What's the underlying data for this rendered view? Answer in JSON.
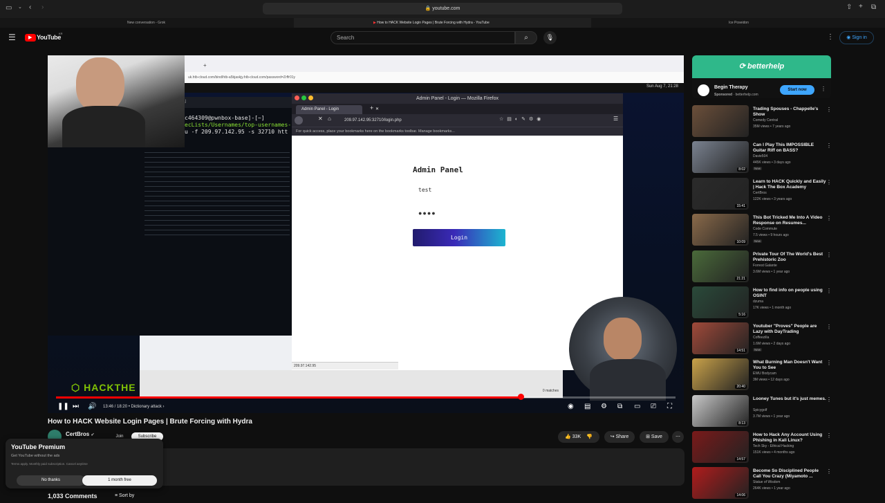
{
  "browser": {
    "url": "youtube.com",
    "tabs": [
      {
        "label": "New conversation - Grok"
      },
      {
        "label": "How to HACK Website Login Pages | Brute Forcing with Hydra - YouTube"
      },
      {
        "label": "Ice Poseidon"
      }
    ]
  },
  "youtube": {
    "logo": "YouTube",
    "logo_badge": "KR",
    "search_placeholder": "Search",
    "sign_in": "Sign in"
  },
  "video": {
    "inner_url": "uk.htb-cloud.com/bind/htb-a5bjaskjy.htb-cloud.com/password=Zrffr01y",
    "clock": "Sun Aug 7, 21:28",
    "terminal_title": "Parrot Terminal",
    "terminal_lines": [
      "c464309@pwnbox-base]-[~]",
      "ecLists/Usernames/top-usernames-",
      "u  -f 209.97.142.95 -s 32710 htt"
    ],
    "firefox_title": "Admin Panel - Login — Mozilla Firefox",
    "firefox_tab": "Admin Panel - Login",
    "firefox_url": "209.97.142.95:32710/login.php",
    "bookmarks_text": "For quick access, place your bookmarks here on the bookmarks toolbar. Manage bookmarks...",
    "admin_title": "Admin Panel",
    "username_value": "test",
    "password_value": "●●●●",
    "login_label": "Login",
    "status_url": "209.97.142.95",
    "brand": "HACKTHE",
    "matches": "0 matches",
    "time": "13:46 / 18:20",
    "chapter": "Dictionary attack",
    "progress": 0.75
  },
  "meta": {
    "title": "How to HACK Website Login Pages | Brute Forcing with Hydra",
    "channel": "CertBros",
    "join": "Join",
    "subscribe": "Subscribe",
    "likes": "33K",
    "share": "Share",
    "save": "Save",
    "comments": "1,033 Comments",
    "sort_by": "Sort by"
  },
  "premium_popup": {
    "title": "YouTube Premium",
    "subtitle": "Get YouTube without the ads",
    "terms": "Terms apply. Monthly paid subscription. Cancel anytime",
    "no_thanks": "No thanks",
    "trial": "1 month free"
  },
  "ad": {
    "brand": "betterhelp",
    "title": "Begin Therapy",
    "sponsored": "Sponsored",
    "domain": "betterhelp.com",
    "cta": "Start now"
  },
  "recommendations": [
    {
      "title": "Trading Spouses - Chappelle's Show",
      "channel": "Comedy Central",
      "meta": "35M views • 7 years ago",
      "badge": "",
      "duration": "",
      "color": "#6b4f3a"
    },
    {
      "title": "Can I Play This IMPOSSIBLE Guitar Riff on BASS?",
      "channel": "Davie504",
      "meta": "445K views • 3 days ago",
      "badge": "New",
      "duration": "8:02",
      "color": "#7a8290"
    },
    {
      "title": "Learn to HACK Quickly and Easily | Hack The Box Academy",
      "channel": "CertBros",
      "meta": "122K views • 3 years ago",
      "badge": "",
      "duration": "15:41",
      "color": "#2b2b2b"
    },
    {
      "title": "This Bot Tricked Me Into A Video Response on Resumes...",
      "channel": "Code Commute",
      "meta": "7.5 views • 9 hours ago",
      "badge": "New",
      "duration": "10:09",
      "color": "#8a6a4a"
    },
    {
      "title": "Private Tour Of The World's Best Prehistoric Zoo",
      "channel": "Forrest Galante",
      "meta": "3.6M views • 1 year ago",
      "badge": "",
      "duration": "21:21",
      "color": "#4a6a3a"
    },
    {
      "title": "How to find info on people using OSINT",
      "channel": "dzuma",
      "meta": "17K views • 1 month ago",
      "badge": "",
      "duration": "5:16",
      "color": "#2a4a3a"
    },
    {
      "title": "Youtuber \"Proves\" People are Lazy with DayTrading",
      "channel": "Coffeezilla",
      "meta": "1.6M views • 2 days ago",
      "badge": "New",
      "duration": "14:51",
      "color": "#a04a3a"
    },
    {
      "title": "What Burning Man Doesn't Want You to See",
      "channel": "EWU Bodycam",
      "meta": "3M views • 12 days ago",
      "badge": "",
      "duration": "20:40",
      "color": "#c9a24a"
    },
    {
      "title": "Looney Tunes but it's just memes.",
      "channel": "Spicygolf",
      "meta": "3.7M views • 1 year ago",
      "badge": "",
      "duration": "8:13",
      "color": "#c8c8c8"
    },
    {
      "title": "How to Hack Any Account Using Phishing in Kali Linux?",
      "channel": "Tech Sky - Ethical Hacking",
      "meta": "151K views • 4 months ago",
      "badge": "",
      "duration": "14:57",
      "color": "#7a1a1a"
    },
    {
      "title": "Become So Disciplined People Call You Crazy (Miyamoto ...",
      "channel": "Statue of Wisdom",
      "meta": "264K views • 1 year ago",
      "badge": "",
      "duration": "14:06",
      "color": "#b01c1c"
    }
  ]
}
